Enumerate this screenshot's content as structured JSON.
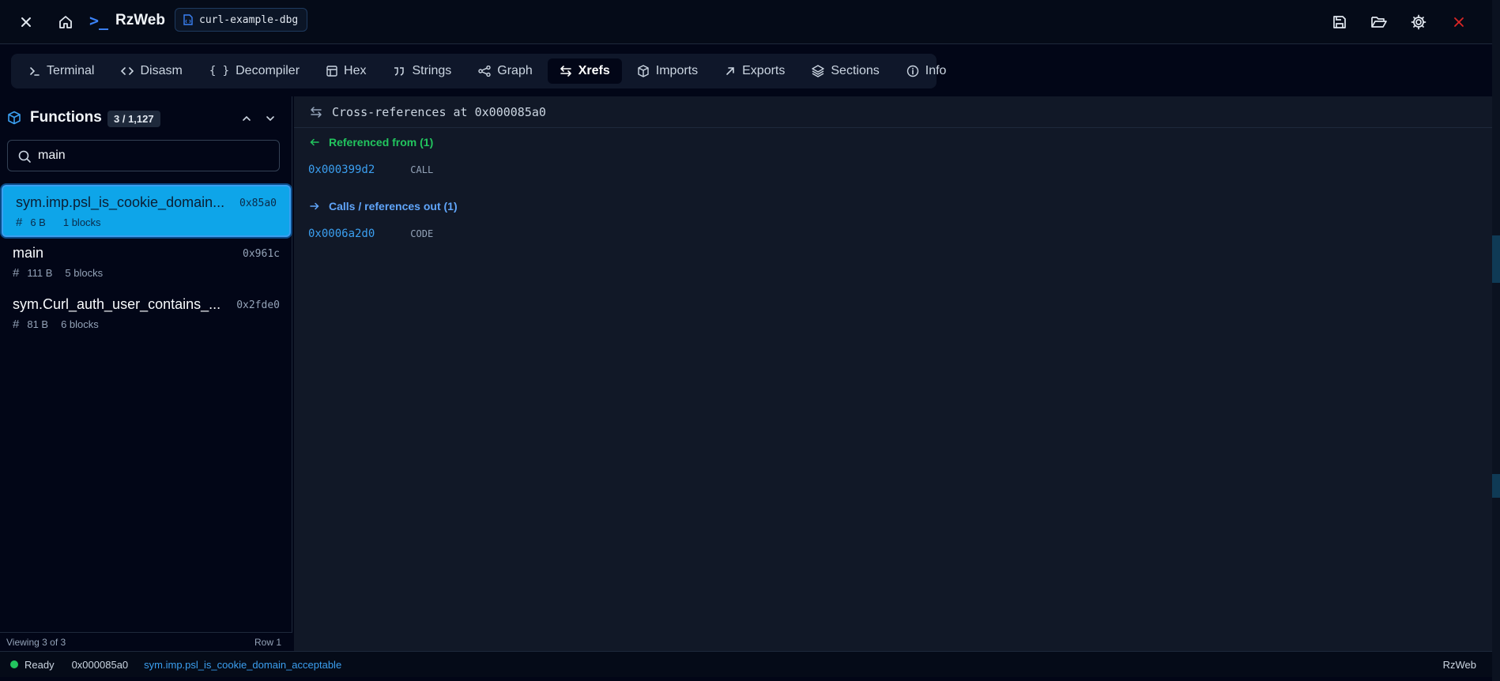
{
  "app": {
    "brand_icon": ">_",
    "brand_name": "RzWeb",
    "file_name": "curl-example-dbg"
  },
  "tabs": [
    {
      "label": "Terminal",
      "icon": "terminal-icon",
      "active": false
    },
    {
      "label": "Disasm",
      "icon": "code-icon",
      "active": false
    },
    {
      "label": "Decompiler",
      "icon": "braces-icon",
      "active": false
    },
    {
      "label": "Hex",
      "icon": "table-icon",
      "active": false
    },
    {
      "label": "Strings",
      "icon": "quote-icon",
      "active": false
    },
    {
      "label": "Graph",
      "icon": "share-icon",
      "active": false
    },
    {
      "label": "Xrefs",
      "icon": "arrows-swap-icon",
      "active": true
    },
    {
      "label": "Imports",
      "icon": "package-icon",
      "active": false
    },
    {
      "label": "Exports",
      "icon": "arrow-up-right-icon",
      "active": false
    },
    {
      "label": "Sections",
      "icon": "layers-icon",
      "active": false
    },
    {
      "label": "Info",
      "icon": "info-icon",
      "active": false
    }
  ],
  "functions": {
    "title": "Functions",
    "count": "3 / 1,127",
    "search_value": "main",
    "items": [
      {
        "name": "sym.imp.psl_is_cookie_domain...",
        "address": "0x85a0",
        "size": "6 B",
        "blocks": "1 blocks",
        "selected": true
      },
      {
        "name": "main",
        "address": "0x961c",
        "size": "111 B",
        "blocks": "5 blocks",
        "selected": false
      },
      {
        "name": "sym.Curl_auth_user_contains_...",
        "address": "0x2fde0",
        "size": "81 B",
        "blocks": "6 blocks",
        "selected": false
      }
    ],
    "footer_left": "Viewing 3 of 3",
    "footer_right": "Row 1"
  },
  "xrefs": {
    "header": "Cross-references at 0x000085a0",
    "from_title": "Referenced from (1)",
    "from": [
      {
        "address": "0x000399d2",
        "type": "CALL"
      }
    ],
    "out_title": "Calls / references out (1)",
    "out": [
      {
        "address": "0x0006a2d0",
        "type": "CODE"
      }
    ]
  },
  "status": {
    "state": "Ready",
    "address": "0x000085a0",
    "symbol": "sym.imp.psl_is_cookie_domain_acceptable",
    "right": "RzWeb"
  },
  "colors": {
    "accent": "#0ea5e9",
    "from_green": "#22c55e",
    "out_blue": "#60a5fa",
    "close_red": "#dc2626"
  }
}
